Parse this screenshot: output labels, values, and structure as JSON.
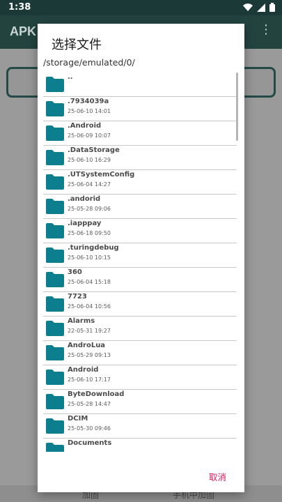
{
  "status_bar": {
    "time": "1:38"
  },
  "app_bar": {
    "title": "APK I"
  },
  "bottom_nav": {
    "left_label": "加固",
    "right_label": "手机中加固"
  },
  "dialog": {
    "title": "选择文件",
    "path": "/storage/emulated/0/",
    "cancel_label": "取消",
    "accent_color": "#e0185f",
    "folder_color": "#0c7e8e",
    "items": [
      {
        "name": "..",
        "date": ""
      },
      {
        "name": ".7934039a",
        "date": "25-06-10 14:01"
      },
      {
        "name": ".Android",
        "date": "25-06-09 10:07"
      },
      {
        "name": ".DataStorage",
        "date": "25-06-10 16:29"
      },
      {
        "name": ".UTSystemConfig",
        "date": "25-06-04 14:27"
      },
      {
        "name": ".andorid",
        "date": "25-05-28 09:06"
      },
      {
        "name": ".iapppay",
        "date": "25-06-18 09:50"
      },
      {
        "name": ".turingdebug",
        "date": "25-06-10 10:15"
      },
      {
        "name": "360",
        "date": "25-06-04 15:18"
      },
      {
        "name": "7723",
        "date": "25-06-04 10:56"
      },
      {
        "name": "Alarms",
        "date": "22-05-31 19:27"
      },
      {
        "name": "AndroLua",
        "date": "25-05-29 09:13"
      },
      {
        "name": "Android",
        "date": "25-06-10 17:17"
      },
      {
        "name": "ByteDownload",
        "date": "25-05-28 14:47"
      },
      {
        "name": "DCIM",
        "date": "25-05-30 09:46"
      },
      {
        "name": "Documents",
        "date": ""
      }
    ]
  }
}
